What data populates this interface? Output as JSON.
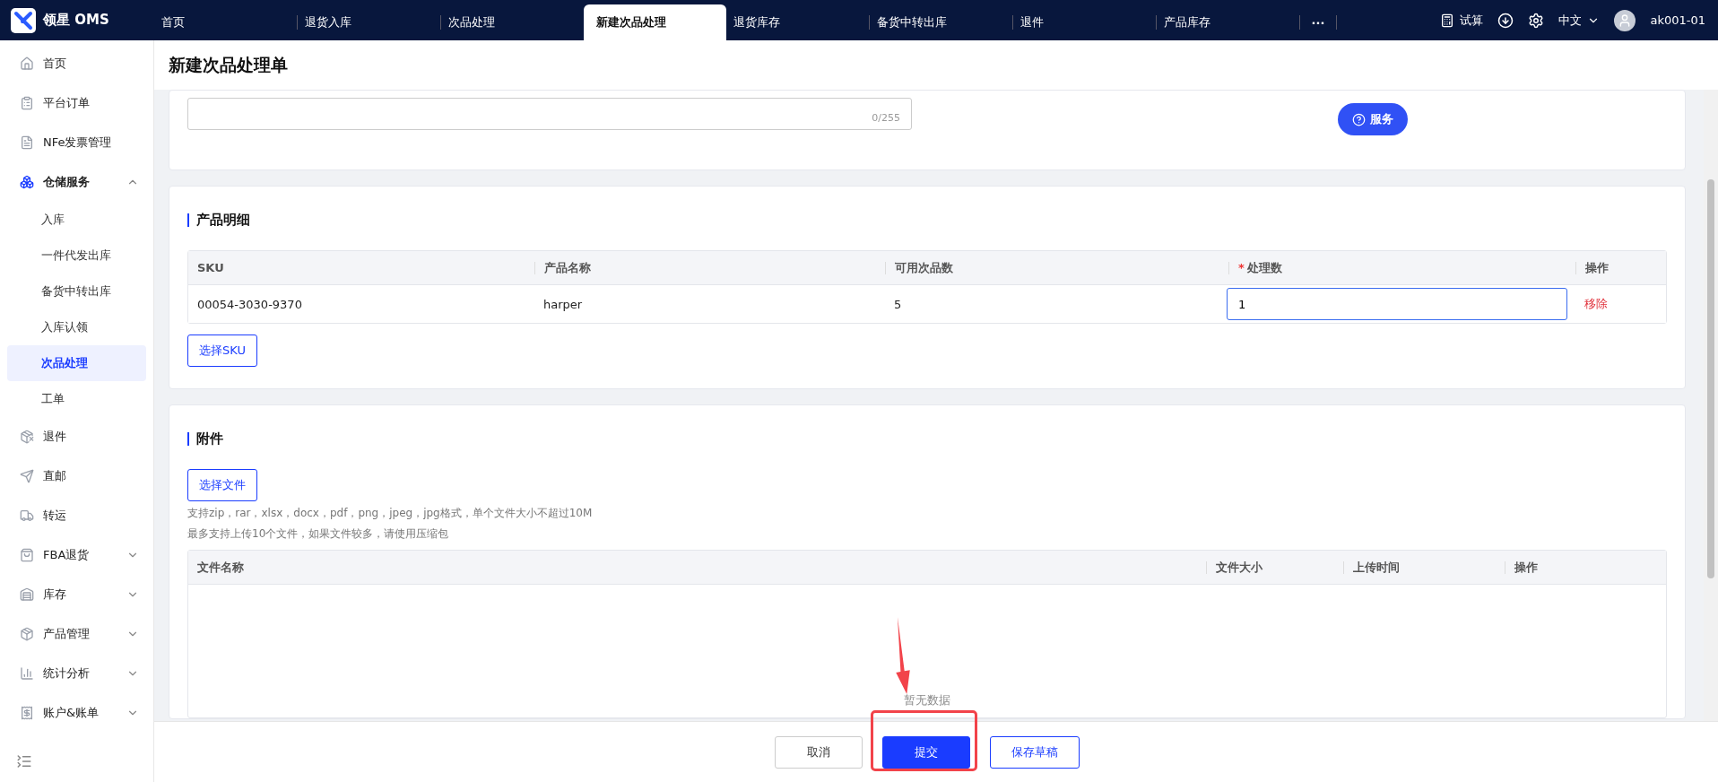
{
  "header": {
    "logo_text": "领星 OMS",
    "more": "···",
    "calc": "试算",
    "language": "中文",
    "user": "ak001-01"
  },
  "tabs": [
    {
      "label": "首页",
      "selected": false
    },
    {
      "label": "退货入库",
      "selected": false
    },
    {
      "label": "次品处理",
      "selected": false
    },
    {
      "label": "新建次品处理",
      "selected": true
    },
    {
      "label": "退货库存",
      "selected": false
    },
    {
      "label": "备货中转出库",
      "selected": false
    },
    {
      "label": "退件",
      "selected": false
    },
    {
      "label": "产品库存",
      "selected": false
    }
  ],
  "sidebar": {
    "items": [
      {
        "label": "首页",
        "selected": false
      },
      {
        "label": "平台订单",
        "selected": false
      },
      {
        "label": "NFe发票管理",
        "selected": false
      },
      {
        "label": "仓储服务",
        "selected": false,
        "expanded": true,
        "children": [
          {
            "label": "入库",
            "selected": false
          },
          {
            "label": "一件代发出库",
            "selected": false
          },
          {
            "label": "备货中转出库",
            "selected": false
          },
          {
            "label": "入库认领",
            "selected": false
          },
          {
            "label": "次品处理",
            "selected": true
          },
          {
            "label": "工单",
            "selected": false
          }
        ]
      },
      {
        "label": "退件",
        "selected": false
      },
      {
        "label": "直邮",
        "selected": false
      },
      {
        "label": "转运",
        "selected": false
      },
      {
        "label": "FBA退货",
        "selected": false,
        "expanded": false
      },
      {
        "label": "库存",
        "selected": false,
        "expanded": false
      },
      {
        "label": "产品管理",
        "selected": false,
        "expanded": false
      },
      {
        "label": "统计分析",
        "selected": false,
        "expanded": false
      },
      {
        "label": "账户&账单",
        "selected": false,
        "expanded": false
      }
    ]
  },
  "page_title": "新建次品处理单",
  "remark": {
    "counter": "0/255"
  },
  "service_button": "服务",
  "products": {
    "title": "产品明细",
    "columns": [
      {
        "label": "SKU"
      },
      {
        "label": "产品名称"
      },
      {
        "label": "可用次品数"
      },
      {
        "label": "处理数",
        "required_mark": "*"
      },
      {
        "label": "操作"
      }
    ],
    "rows": [
      {
        "sku": "00054-3030-9370",
        "name": "harper",
        "available": "5",
        "quantity": "1",
        "action": "移除"
      }
    ],
    "add_button": "选择SKU"
  },
  "attachments": {
    "title": "附件",
    "button": "选择文件",
    "hints": [
      "支持zip，rar，xlsx，docx，pdf，png，jpeg，jpg格式，单个文件大小不超过10M",
      "最多支持上传10个文件，如果文件较多，请使用压缩包"
    ],
    "columns": [
      "文件名称",
      "文件大小",
      "上传时间",
      "操作"
    ],
    "empty": "暂无数据"
  },
  "footer_buttons": [
    {
      "label": "取消",
      "kind": "default"
    },
    {
      "label": "提交",
      "kind": "primary"
    },
    {
      "label": "保存草稿",
      "kind": "outline"
    }
  ]
}
